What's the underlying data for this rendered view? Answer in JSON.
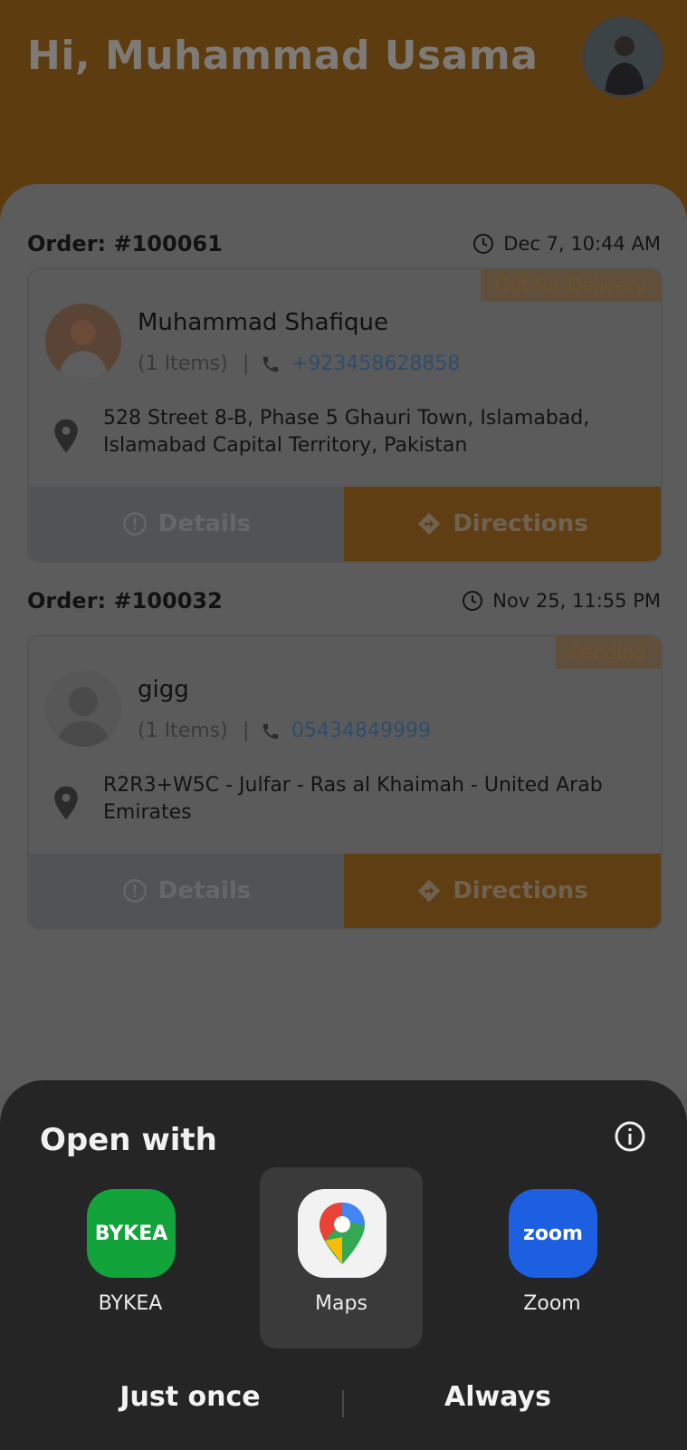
{
  "header": {
    "greeting": "Hi, Muhammad Usama"
  },
  "orders": [
    {
      "order_label": "Order: #100061",
      "time": "Dec 7, 10:44 AM",
      "status": "Out for Delivery",
      "customer_name": "Muhammad Shafique",
      "items": "(1 Items)",
      "separator": "|",
      "phone": "+923458628858",
      "address": "528 Street 8-B, Phase 5 Ghauri Town, Islamabad, Islamabad Capital Territory, Pakistan",
      "details_label": "Details",
      "directions_label": "Directions"
    },
    {
      "order_label": "Order: #100032",
      "time": "Nov 25, 11:55 PM",
      "status": "Pending",
      "customer_name": "gigg",
      "items": "(1 Items)",
      "separator": "|",
      "phone": "05434849999",
      "address": "R2R3+W5C - Julfar - Ras al Khaimah - United Arab Emirates",
      "details_label": "Details",
      "directions_label": "Directions"
    }
  ],
  "sheet": {
    "title": "Open with",
    "apps": [
      {
        "label": "BYKEA",
        "icon_text": "BYKEA",
        "icon": "bykea-app-icon",
        "color": "#12a33a"
      },
      {
        "label": "Maps",
        "icon": "google-maps-app-icon",
        "color": "#f2f2f2",
        "selected": true
      },
      {
        "label": "Zoom",
        "icon_text": "zoom",
        "icon": "zoom-app-icon",
        "color": "#1c5fe0"
      }
    ],
    "just_once": "Just once",
    "always": "Always"
  }
}
